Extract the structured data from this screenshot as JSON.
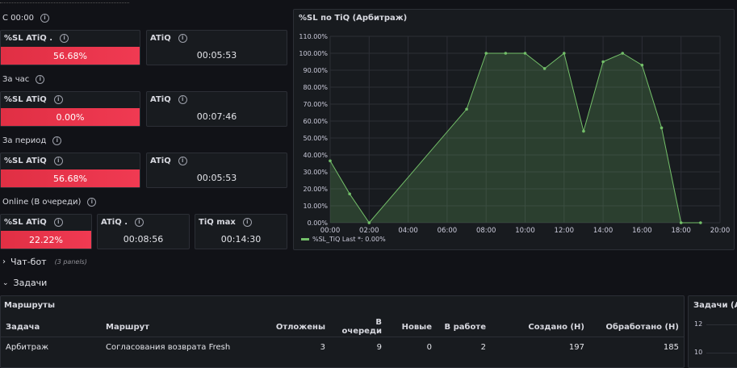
{
  "sections": {
    "since_midnight": "С 00:00",
    "per_hour": "За час",
    "per_period": "За период",
    "online": "Online (В очереди)"
  },
  "stats": {
    "s1_sl_label": "%SL ATiQ .",
    "s1_sl_value": "56.68%",
    "s1_sl_fill": 1.0,
    "s1_atiq_label": "ATiQ",
    "s1_atiq_value": "00:05:53",
    "s2_sl_label": "%SL ATiQ",
    "s2_sl_value": "0.00%",
    "s2_atiq_label": "ATiQ",
    "s2_atiq_value": "00:07:46",
    "s3_sl_label": "%SL ATiQ",
    "s3_sl_value": "56.68%",
    "s3_atiq_label": "ATiQ",
    "s3_atiq_value": "00:05:53",
    "s4_sl_label": "%SL ATiQ",
    "s4_sl_value": "22.22%",
    "s4_atiq_label": "ATiQ .",
    "s4_atiq_value": "00:08:56",
    "s4_tiqmax_label": "TiQ max",
    "s4_tiqmax_value": "00:14:30"
  },
  "rows": {
    "chatbot": "Чат-бот",
    "chatbot_meta": "(3 panels)",
    "tasks": "Задачи"
  },
  "routes_table": {
    "title": "Маршруты",
    "headers": [
      "Задача",
      "Маршрут",
      "Отложены",
      "В очереди",
      "Новые",
      "В работе",
      "Создано (Н)",
      "Обработано (Н)"
    ],
    "rows": [
      [
        "Арбитраж",
        "Согласования возврата Fresh",
        "3",
        "9",
        "0",
        "2",
        "197",
        "185"
      ]
    ]
  },
  "right_panel": {
    "title": "Задачи (Ар",
    "ticks": [
      "12",
      "10"
    ]
  },
  "chart_data": {
    "type": "area",
    "title": "%SL по TiQ (Арбитраж)",
    "xlabel": "",
    "ylabel": "",
    "x_ticks": [
      "00:00",
      "02:00",
      "04:00",
      "06:00",
      "08:00",
      "10:00",
      "12:00",
      "14:00",
      "16:00",
      "18:00",
      "20:00"
    ],
    "y_ticks": [
      "0.00%",
      "10.00%",
      "20.00%",
      "30.00%",
      "40.00%",
      "50.00%",
      "60.00%",
      "70.00%",
      "80.00%",
      "90.00%",
      "100.00%",
      "110.00%"
    ],
    "xlim": [
      0,
      20
    ],
    "ylim": [
      0,
      110
    ],
    "grid": true,
    "color": "#73bf69",
    "legend_position": "bottom-left",
    "legend": "%SL_TiQ  Last *: 0.00%",
    "series": [
      {
        "name": "%SL_TiQ",
        "x": [
          0,
          1,
          2,
          7,
          8,
          9,
          10,
          11,
          12,
          13,
          14,
          15,
          16,
          17,
          18,
          19
        ],
        "y": [
          36.5,
          17,
          0,
          67,
          100,
          100,
          100,
          91,
          100,
          54,
          95,
          100,
          93,
          56,
          0,
          0
        ]
      }
    ]
  }
}
